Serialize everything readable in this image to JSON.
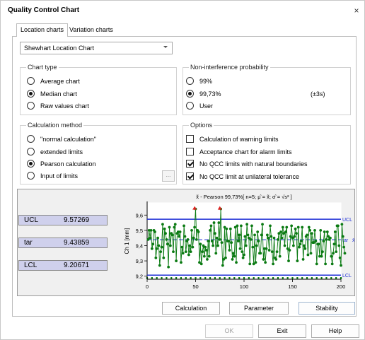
{
  "window": {
    "title": "Quality Control Chart",
    "close_glyph": "×"
  },
  "tabs": [
    {
      "label": "Location charts",
      "active": true
    },
    {
      "label": "Variation charts",
      "active": false
    }
  ],
  "chart_selector": {
    "value": "Shewhart Location Chart"
  },
  "chart_type": {
    "legend": "Chart type",
    "options": [
      {
        "label": "Average chart",
        "selected": false
      },
      {
        "label": "Median chart",
        "selected": true
      },
      {
        "label": "Raw values chart",
        "selected": false
      }
    ]
  },
  "non_interference": {
    "legend": "Non-interference probability",
    "options": [
      {
        "label": "99%",
        "selected": false
      },
      {
        "label": "99,73%",
        "selected": true
      },
      {
        "label": "User",
        "selected": false
      }
    ],
    "sigma_note": "(±3s)"
  },
  "calc_method": {
    "legend": "Calculation method",
    "options": [
      {
        "label": "\"normal calculation\"",
        "selected": false
      },
      {
        "label": "extended limits",
        "selected": false
      },
      {
        "label": "Pearson calculation",
        "selected": true
      },
      {
        "label": "Input of limits",
        "selected": false
      }
    ],
    "ellipsis_label": "..."
  },
  "options": {
    "legend": "Options",
    "items": [
      {
        "label": "Calculation of warning limits",
        "checked": false
      },
      {
        "label": "Acceptance chart for alarm limits",
        "checked": false
      },
      {
        "label": "No QCC limits with natural boundaries",
        "checked": true
      },
      {
        "label": "No QCC limit at unilateral tolerance",
        "checked": true
      }
    ]
  },
  "limits": [
    {
      "label": "UCL",
      "value": "9.57269"
    },
    {
      "label": "tar",
      "value": "9.43859"
    },
    {
      "label": "LCL",
      "value": "9.20671"
    }
  ],
  "colors": {
    "ucl_line": "#1e2fd6",
    "center_line": "#1e2fd6",
    "lcl_line": "#1e2fd6",
    "series": "#0a7a12",
    "outlier": "#e02020",
    "zero_line": "#000000"
  },
  "chart_data": {
    "type": "line",
    "title": "x̃ - Pearson 99,73%[ n=5; μ̂ = x̃; σ̂ = √s² ]",
    "ylabel": "Ch 1 [mm]",
    "xlim": [
      0,
      200
    ],
    "ylim": [
      9.18,
      9.68
    ],
    "xticks": [
      0,
      50,
      100,
      150,
      200
    ],
    "yticks": [
      "9,2",
      "9,3",
      "9,4",
      "9,5",
      "9,6"
    ],
    "ytick_values": [
      9.2,
      9.3,
      9.4,
      9.5,
      9.6
    ],
    "ucl": 9.57269,
    "center": 9.43859,
    "lcl": 9.20671,
    "right_labels": {
      "ucl": "UCL",
      "center": "tar",
      "center_symbol": "x̄",
      "lcl": "LCL"
    },
    "series": [
      {
        "values": [
          9.44,
          9.5,
          9.45,
          9.5,
          9.38,
          9.41,
          9.5,
          9.49,
          9.32,
          9.38,
          9.45,
          9.4,
          9.27,
          9.36,
          9.39,
          9.54,
          9.32,
          9.51,
          9.48,
          9.44,
          9.41,
          9.26,
          9.52,
          9.4,
          9.48,
          9.47,
          9.36,
          9.52,
          9.54,
          9.3,
          9.48,
          9.49,
          9.46,
          9.49,
          9.29,
          9.39,
          9.35,
          9.53,
          9.46,
          9.36,
          9.43,
          9.44,
          9.34,
          9.4,
          9.36,
          9.5,
          9.39,
          9.45,
          9.52,
          9.64,
          9.44,
          9.5,
          9.49,
          9.29,
          9.41,
          9.28,
          9.36,
          9.4,
          9.33,
          9.39,
          9.37,
          9.31,
          9.43,
          9.33,
          9.5,
          9.53,
          9.43,
          9.4,
          9.55,
          9.48,
          9.35,
          9.45,
          9.4,
          9.55,
          9.44,
          9.64,
          9.42,
          9.27,
          9.31,
          9.52,
          9.32,
          9.51,
          9.43,
          9.43,
          9.37,
          9.51,
          9.42,
          9.31,
          9.35,
          9.33,
          9.52,
          9.29,
          9.53,
          9.43,
          9.47,
          9.38,
          9.53,
          9.36,
          9.32,
          9.34,
          9.46,
          9.4,
          9.54,
          9.47,
          9.45,
          9.28,
          9.44,
          9.53,
          9.39,
          9.28,
          9.47,
          9.29,
          9.4,
          9.49,
          9.43,
          9.35,
          9.35,
          9.47,
          9.54,
          9.31,
          9.38,
          9.29,
          9.38,
          9.47,
          9.45,
          9.37,
          9.53,
          9.46,
          9.36,
          9.28,
          9.45,
          9.32,
          9.31,
          9.36,
          9.44,
          9.48,
          9.33,
          9.49,
          9.45,
          9.52,
          9.48,
          9.4,
          9.49,
          9.52,
          9.38,
          9.3,
          9.37,
          9.46,
          9.53,
          9.45,
          9.4,
          9.46,
          9.51,
          9.48,
          9.3,
          9.52,
          9.39,
          9.41,
          9.43,
          9.52,
          9.31,
          9.4,
          9.38,
          9.46,
          9.47,
          9.34,
          9.52,
          9.5,
          9.35,
          9.48,
          9.42,
          9.42,
          9.5,
          9.43,
          9.28,
          9.41,
          9.41,
          9.33,
          9.5,
          9.33,
          9.36,
          9.43,
          9.49,
          9.28,
          9.44,
          9.49,
          9.46,
          9.44,
          9.45,
          9.33,
          9.28,
          9.35,
          9.41,
          9.49,
          9.36,
          9.53,
          9.53,
          9.4,
          9.32,
          9.27,
          9.54,
          9.46,
          9.39,
          9.35
        ]
      }
    ],
    "outliers": [
      {
        "x": 49,
        "y": 9.64
      },
      {
        "x": 75,
        "y": 9.64
      }
    ]
  },
  "chart_buttons": {
    "calculation": "Calculation",
    "parameter": "Parameter",
    "stability": "Stability"
  },
  "footer_buttons": {
    "ok": "OK",
    "exit": "Exit",
    "help": "Help"
  }
}
